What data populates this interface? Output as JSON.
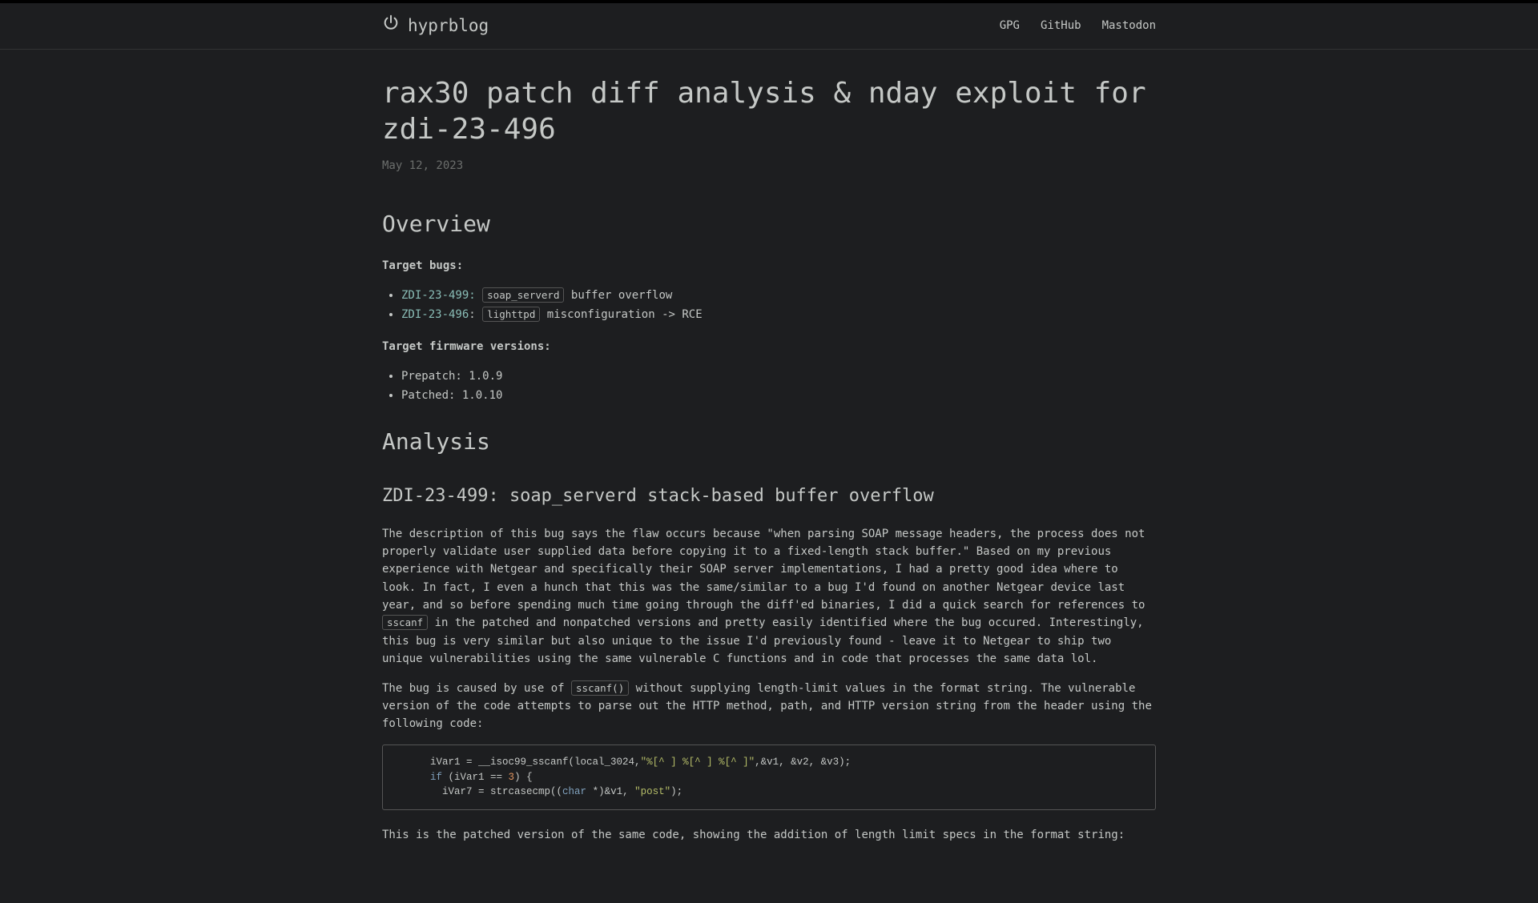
{
  "brand": {
    "name": "hyprblog"
  },
  "nav": {
    "gpg": "GPG",
    "github": "GitHub",
    "mastodon": "Mastodon"
  },
  "post": {
    "title": "rax30 patch diff analysis & nday exploit for zdi-23-496",
    "date": "May 12, 2023",
    "overview_heading": "Overview",
    "target_bugs_label": "Target bugs:",
    "bugs": {
      "zdi499_link": "ZDI-23-499:",
      "zdi499_code": "soap_serverd",
      "zdi499_desc": " buffer overflow",
      "zdi496_link": "ZDI-23-496",
      "zdi496_colon": ": ",
      "zdi496_code": "lighttpd",
      "zdi496_desc": " misconfiguration -> RCE"
    },
    "target_fw_label": "Target firmware versions:",
    "fw": {
      "prepatch": "Prepatch: 1.0.9",
      "patched": "Patched: 1.0.10"
    },
    "analysis_heading": "Analysis",
    "zdi499_heading": "ZDI-23-499: soap_serverd stack-based buffer overflow",
    "para1_a": "The description of this bug says the flaw occurs because \"when parsing SOAP message headers, the process does not properly validate user supplied data before copying it to a fixed-length stack buffer.\" Based on my previous experience with Netgear and specifically their SOAP server implementations, I had a pretty good idea where to look. In fact, I even a hunch that this was the same/similar to a bug I'd found on another Netgear device last year, and so before spending much time going through the diff'ed binaries, I did a quick search for references to ",
    "para1_code": "sscanf",
    "para1_b": " in the patched and nonpatched versions and pretty easily identified where the bug occured. Interestingly, this bug is very similar but also unique to the issue I'd previously found - leave it to Netgear to ship two unique vulnerabilities using the same vulnerable C functions and in code that processes the same data lol.",
    "para2_a": "The bug is caused by use of ",
    "para2_code": "sscanf()",
    "para2_b": " without supplying length-limit values in the format string. The vulnerable version of the code attempts to parse out the HTTP method, path, and HTTP version string from the header using the following code:",
    "code1": {
      "l1a": "      iVar1 = __isoc99_sscanf(local_3024,",
      "l1s": "\"%[^ ] %[^ ] %[^ ]\"",
      "l1b": ",&v1, &v2, &v3);",
      "l2a": "      ",
      "l2kw": "if",
      "l2b": " (iVar1 == ",
      "l2n": "3",
      "l2c": ") {",
      "l3a": "        iVar7 = strcasecmp((",
      "l3t": "char",
      "l3b": " *)&v1, ",
      "l3s": "\"post\"",
      "l3c": ");"
    },
    "para3": "This is the patched version of the same code, showing the addition of length limit specs in the format string:"
  }
}
